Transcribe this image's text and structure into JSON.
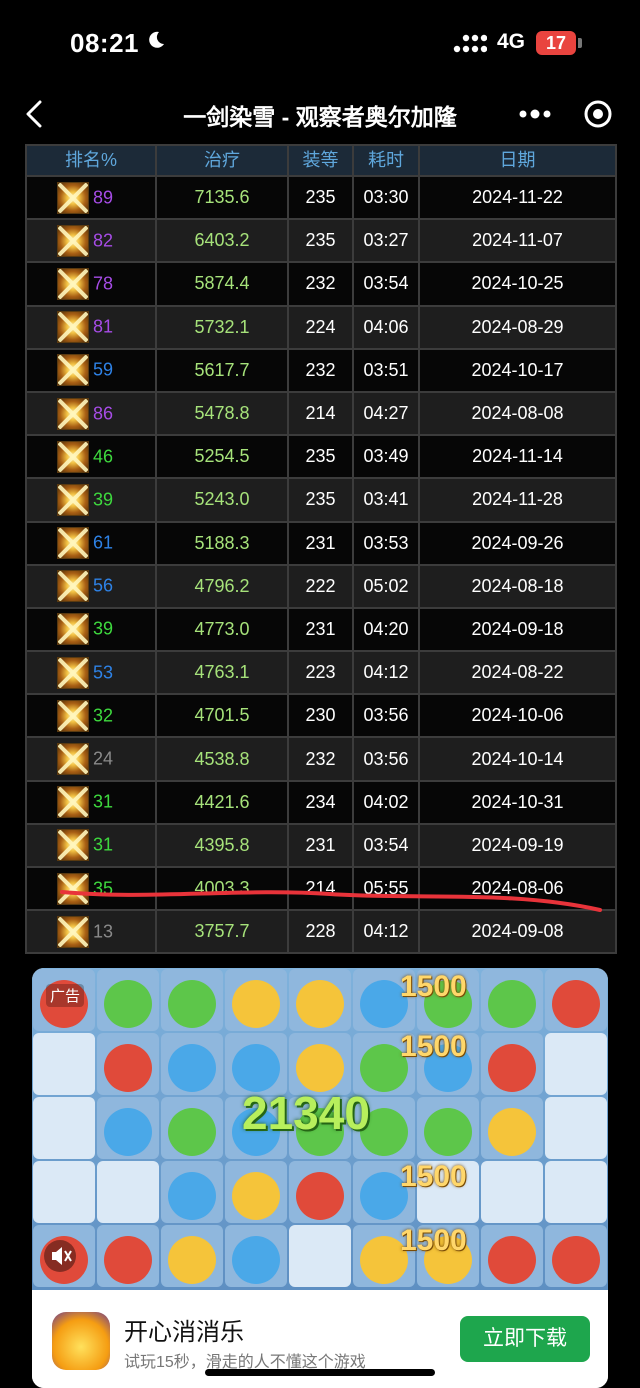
{
  "status": {
    "time": "08:21",
    "network": "4G",
    "battery": "17"
  },
  "nav": {
    "title": "一剑染雪 - 观察者奥尔加隆"
  },
  "table": {
    "headers": [
      "排名%",
      "治疗",
      "装等",
      "耗时",
      "日期"
    ],
    "rows": [
      {
        "rank": "89",
        "heal": "7135.6",
        "ilvl": "235",
        "time": "03:30",
        "date": "2024-11-22"
      },
      {
        "rank": "82",
        "heal": "6403.2",
        "ilvl": "235",
        "time": "03:27",
        "date": "2024-11-07"
      },
      {
        "rank": "78",
        "heal": "5874.4",
        "ilvl": "232",
        "time": "03:54",
        "date": "2024-10-25"
      },
      {
        "rank": "81",
        "heal": "5732.1",
        "ilvl": "224",
        "time": "04:06",
        "date": "2024-08-29"
      },
      {
        "rank": "59",
        "heal": "5617.7",
        "ilvl": "232",
        "time": "03:51",
        "date": "2024-10-17"
      },
      {
        "rank": "86",
        "heal": "5478.8",
        "ilvl": "214",
        "time": "04:27",
        "date": "2024-08-08"
      },
      {
        "rank": "46",
        "heal": "5254.5",
        "ilvl": "235",
        "time": "03:49",
        "date": "2024-11-14"
      },
      {
        "rank": "39",
        "heal": "5243.0",
        "ilvl": "235",
        "time": "03:41",
        "date": "2024-11-28"
      },
      {
        "rank": "61",
        "heal": "5188.3",
        "ilvl": "231",
        "time": "03:53",
        "date": "2024-09-26"
      },
      {
        "rank": "56",
        "heal": "4796.2",
        "ilvl": "222",
        "time": "05:02",
        "date": "2024-08-18"
      },
      {
        "rank": "39",
        "heal": "4773.0",
        "ilvl": "231",
        "time": "04:20",
        "date": "2024-09-18"
      },
      {
        "rank": "53",
        "heal": "4763.1",
        "ilvl": "223",
        "time": "04:12",
        "date": "2024-08-22"
      },
      {
        "rank": "32",
        "heal": "4701.5",
        "ilvl": "230",
        "time": "03:56",
        "date": "2024-10-06"
      },
      {
        "rank": "24",
        "heal": "4538.8",
        "ilvl": "232",
        "time": "03:56",
        "date": "2024-10-14"
      },
      {
        "rank": "31",
        "heal": "4421.6",
        "ilvl": "234",
        "time": "04:02",
        "date": "2024-10-31"
      },
      {
        "rank": "31",
        "heal": "4395.8",
        "ilvl": "231",
        "time": "03:54",
        "date": "2024-09-19"
      },
      {
        "rank": "35",
        "heal": "4003.3",
        "ilvl": "214",
        "time": "05:55",
        "date": "2024-08-06"
      },
      {
        "rank": "13",
        "heal": "3757.7",
        "ilvl": "228",
        "time": "04:12",
        "date": "2024-09-08"
      }
    ]
  },
  "colors": {
    "purple": "#a64ce6",
    "blue": "#2e82e6",
    "green": "#3ed93e",
    "gray": "#8a8a8a",
    "heal": "#a6e27a",
    "header": "#5fa7dc",
    "mark": "#e8333a"
  },
  "ad": {
    "label": "广告",
    "score_big": "21340",
    "scores": [
      "1500",
      "1500",
      "1500",
      "1500"
    ],
    "app_name": "开心消消乐",
    "app_desc": "试玩15秒，滑走的人不懂这个游戏",
    "download": "立即下载"
  }
}
